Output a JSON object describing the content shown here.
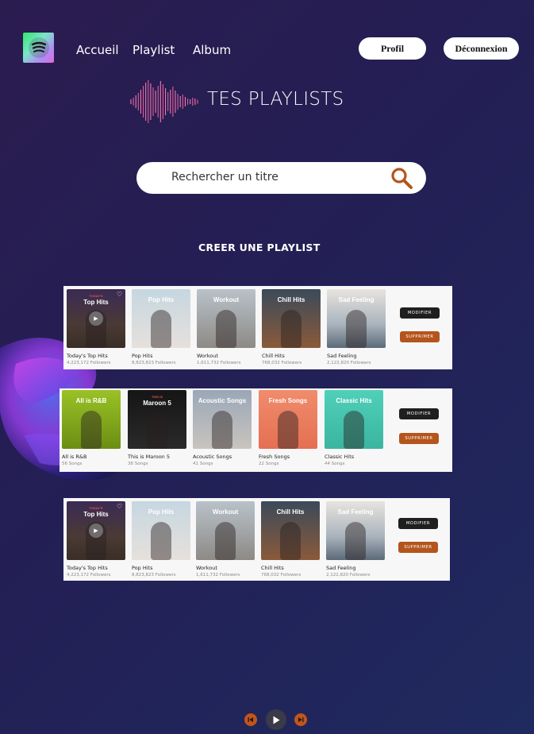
{
  "nav": {
    "links": [
      "Accueil",
      "Playlist",
      "Album"
    ],
    "profile": "Profil",
    "logout": "Déconnexion"
  },
  "page_title": "TES PLAYLISTS",
  "search": {
    "placeholder": "Rechercher un titre"
  },
  "create_label": "CREER UNE PLAYLIST",
  "actions": {
    "modify": "MODIFIER",
    "delete": "SUPPRIMER"
  },
  "rows": [
    {
      "cards": [
        {
          "title": "Today's Top Hits",
          "sub": "4,223,172 Followers",
          "cover_title": "Top Hits",
          "cover_kicker": "TODAY'S"
        },
        {
          "title": "Pop Hits",
          "sub": "8,823,823 Followers",
          "cover_title": "Pop Hits"
        },
        {
          "title": "Workout",
          "sub": "1,611,732 Followers",
          "cover_title": "Workout"
        },
        {
          "title": "Chill Hits",
          "sub": "768,032 Followers",
          "cover_title": "Chill Hits"
        },
        {
          "title": "Sad Feeling",
          "sub": "2,122,820 Followers",
          "cover_title": "Sad Feeling"
        }
      ]
    },
    {
      "cards": [
        {
          "title": "All is R&B",
          "sub": "56 Songs",
          "cover_title": "All is R&B"
        },
        {
          "title": "This is Maroon 5",
          "sub": "36 Songs",
          "cover_title": "Maroon 5",
          "cover_kicker": "THIS IS"
        },
        {
          "title": "Acoustic Songs",
          "sub": "41 Songs",
          "cover_title": "Acoustic Songs"
        },
        {
          "title": "Fresh Songs",
          "sub": "22 Songs",
          "cover_title": "Fresh Songs"
        },
        {
          "title": "Classic Hits",
          "sub": "44 Songs",
          "cover_title": "Classic Hits"
        }
      ]
    },
    {
      "cards": [
        {
          "title": "Today's Top Hits",
          "sub": "4,223,172 Followers",
          "cover_title": "Top Hits",
          "cover_kicker": "TODAY'S"
        },
        {
          "title": "Pop Hits",
          "sub": "8,823,823 Followers",
          "cover_title": "Pop Hits"
        },
        {
          "title": "Workout",
          "sub": "1,611,732 Followers",
          "cover_title": "Workout"
        },
        {
          "title": "Chill Hits",
          "sub": "768,032 Followers",
          "cover_title": "Chill Hits"
        },
        {
          "title": "Sad Feeling",
          "sub": "2,122,820 Followers",
          "cover_title": "Sad Feeling"
        }
      ]
    }
  ],
  "colors": {
    "accent": "#c2551a",
    "modify_btn": "#1f1f1f",
    "delete_btn": "#b4551c"
  },
  "icons": [
    "logo-icon",
    "waveform-icon",
    "search-icon",
    "previous-icon",
    "play-icon",
    "next-icon",
    "heart-icon"
  ]
}
